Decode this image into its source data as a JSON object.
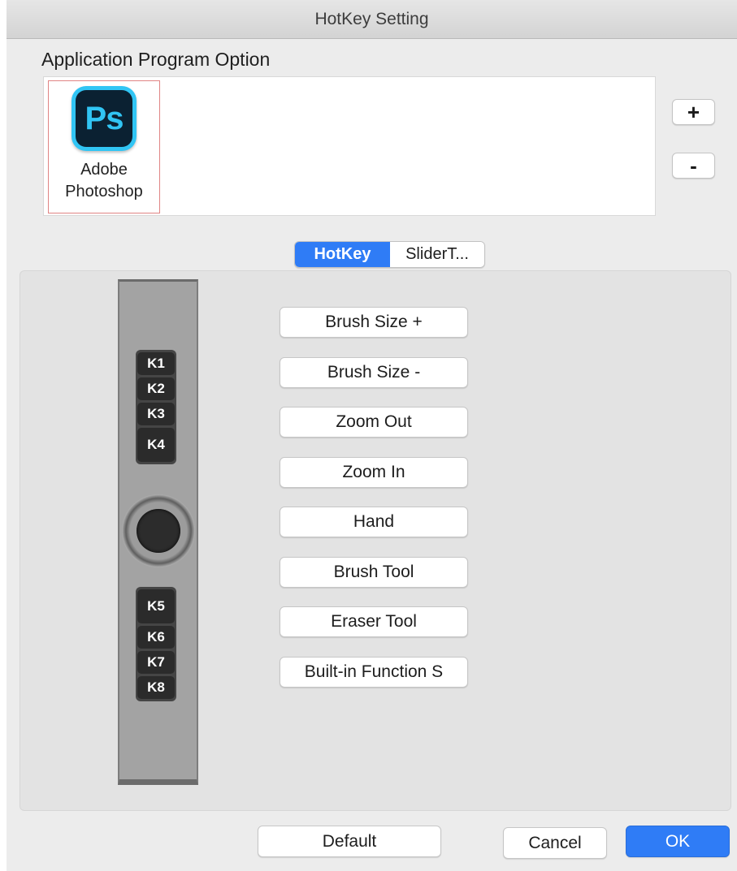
{
  "window": {
    "title": "HotKey Setting"
  },
  "applications": {
    "label": "Application Program Option",
    "items": [
      {
        "name_line1": "Adobe",
        "name_line2": "Photoshop",
        "icon": "photoshop-icon",
        "icon_text": "Ps",
        "selected": true
      }
    ],
    "add_label": "+",
    "remove_label": "-"
  },
  "tabs": [
    {
      "label": "HotKey",
      "active": true
    },
    {
      "label": "SliderT...",
      "active": false
    }
  ],
  "device": {
    "keys_top": [
      "K1",
      "K2",
      "K3",
      "K4"
    ],
    "keys_bottom": [
      "K5",
      "K6",
      "K7",
      "K8"
    ]
  },
  "functions": [
    "Brush Size +",
    "Brush Size -",
    "Zoom Out",
    "Zoom In",
    "Hand",
    "Brush Tool",
    "Eraser Tool",
    "Built-in Function S"
  ],
  "footer": {
    "default_label": "Default",
    "cancel_label": "Cancel",
    "ok_label": "OK"
  },
  "colors": {
    "accent": "#2f7cf6",
    "ps_blue": "#31c5f4",
    "ps_dark": "#0b2132"
  }
}
